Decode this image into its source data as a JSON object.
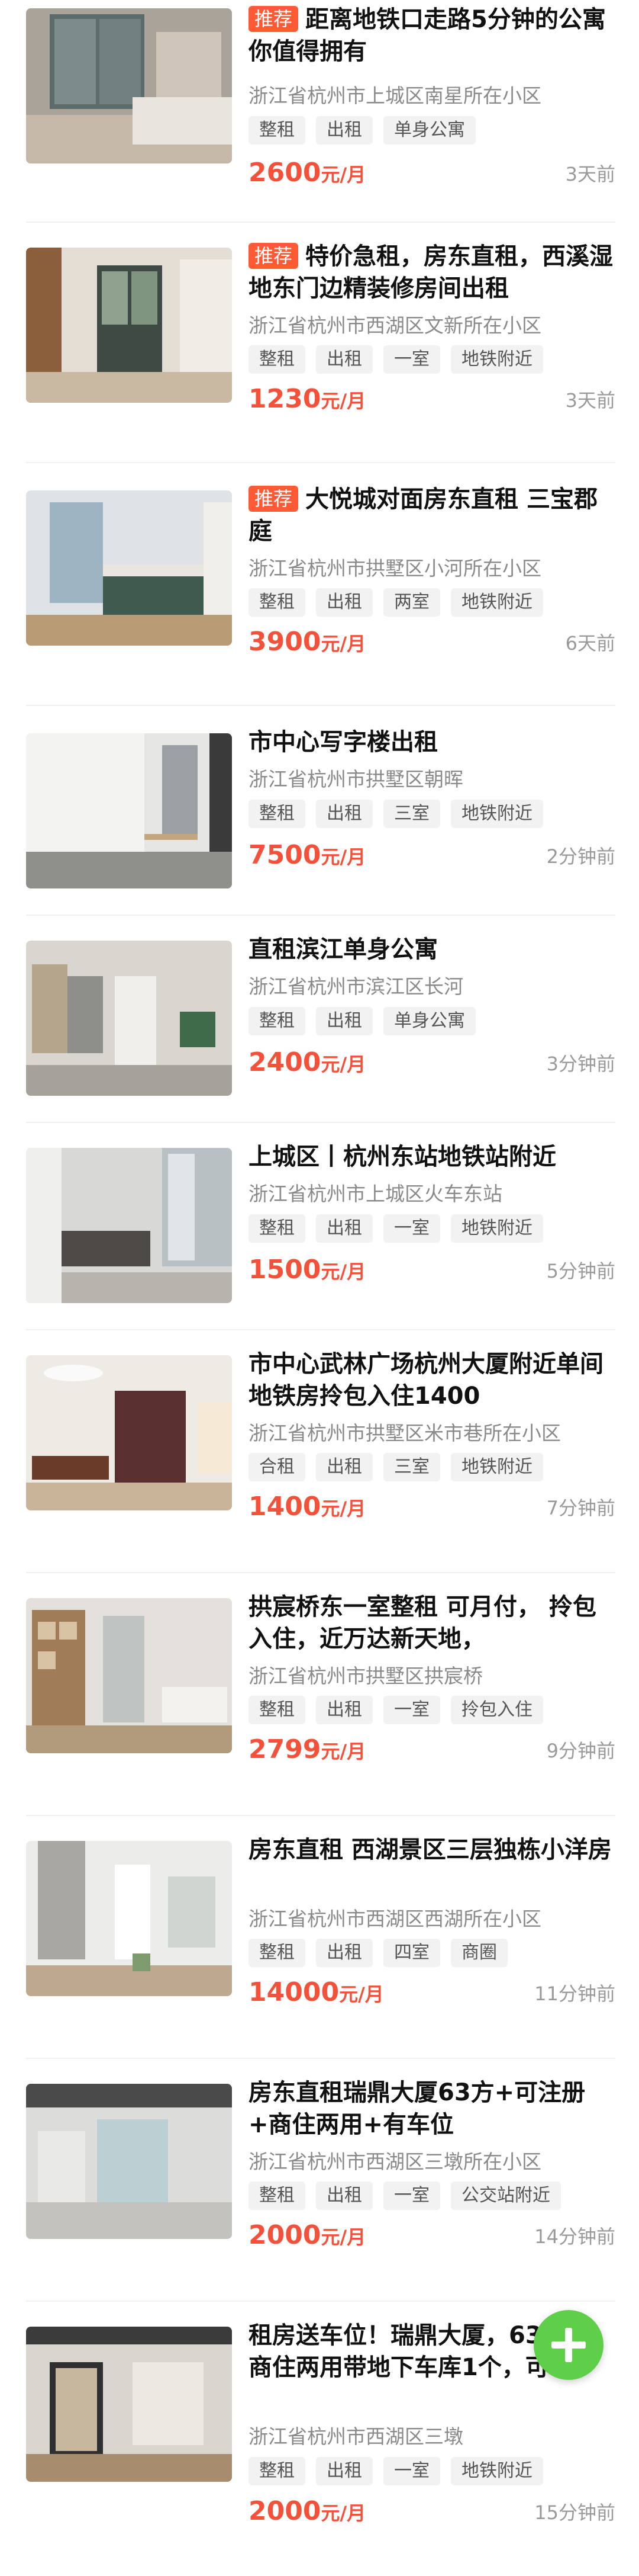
{
  "listings": [
    {
      "recommended": true,
      "badge": "推荐",
      "title": "距离地铁口走路5分钟的公寓你值得拥有",
      "address": "浙江省杭州市上城区南星所在小区",
      "tags": [
        "整租",
        "出租",
        "单身公寓"
      ],
      "price": "2600",
      "unit": "元/月",
      "time": "3天前"
    },
    {
      "recommended": true,
      "badge": "推荐",
      "title": "特价急租，房东直租，西溪湿地东门边精装修房间出租",
      "address": "浙江省杭州市西湖区文新所在小区",
      "tags": [
        "整租",
        "出租",
        "一室",
        "地铁附近"
      ],
      "price": "1230",
      "unit": "元/月",
      "time": "3天前"
    },
    {
      "recommended": true,
      "badge": "推荐",
      "title": "大悦城对面房东直租 三宝郡庭",
      "address": "浙江省杭州市拱墅区小河所在小区",
      "tags": [
        "整租",
        "出租",
        "两室",
        "地铁附近"
      ],
      "price": "3900",
      "unit": "元/月",
      "time": "6天前"
    },
    {
      "recommended": false,
      "title": "市中心写字楼出租",
      "address": "浙江省杭州市拱墅区朝晖",
      "tags": [
        "整租",
        "出租",
        "三室",
        "地铁附近"
      ],
      "price": "7500",
      "unit": "元/月",
      "time": "2分钟前"
    },
    {
      "recommended": false,
      "title": "直租滨江单身公寓",
      "address": "浙江省杭州市滨江区长河",
      "tags": [
        "整租",
        "出租",
        "单身公寓"
      ],
      "price": "2400",
      "unit": "元/月",
      "time": "3分钟前"
    },
    {
      "recommended": false,
      "title": "上城区丨杭州东站地铁站附近",
      "address": "浙江省杭州市上城区火车东站",
      "tags": [
        "整租",
        "出租",
        "一室",
        "地铁附近"
      ],
      "price": "1500",
      "unit": "元/月",
      "time": "5分钟前"
    },
    {
      "recommended": false,
      "title": "市中心武林广场杭州大厦附近单间地铁房拎包入住1400",
      "address": "浙江省杭州市拱墅区米市巷所在小区",
      "tags": [
        "合租",
        "出租",
        "三室",
        "地铁附近"
      ],
      "price": "1400",
      "unit": "元/月",
      "time": "7分钟前"
    },
    {
      "recommended": false,
      "title": "拱宸桥东一室整租 可月付， 拎包入住，近万达新天地，",
      "address": "浙江省杭州市拱墅区拱宸桥",
      "tags": [
        "整租",
        "出租",
        "一室",
        "拎包入住"
      ],
      "price": "2799",
      "unit": "元/月",
      "time": "9分钟前"
    },
    {
      "recommended": false,
      "title": "房东直租 西湖景区三层独栋小洋房",
      "address": "浙江省杭州市西湖区西湖所在小区",
      "tags": [
        "整租",
        "出租",
        "四室",
        "商圈"
      ],
      "price": "14000",
      "unit": "元/月",
      "time": "11分钟前"
    },
    {
      "recommended": false,
      "title": "房东直租瑞鼎大厦63方+可注册+商住两用+有车位",
      "address": "浙江省杭州市西湖区三墩所在小区",
      "tags": [
        "整租",
        "出租",
        "一室",
        "公交站附近"
      ],
      "price": "2000",
      "unit": "元/月",
      "time": "14分钟前"
    },
    {
      "recommended": false,
      "title": "租房送车位！瑞鼎大厦，63平米，商住两用带地下车库1个，可",
      "address": "浙江省杭州市西湖区三墩",
      "tags": [
        "整租",
        "出租",
        "一室",
        "地铁附近"
      ],
      "price": "2000",
      "unit": "元/月",
      "time": "15分钟前"
    }
  ],
  "fab": {
    "icon": "plus-icon"
  },
  "colors": {
    "accent": "#f4513b",
    "badge": "#ff5a36",
    "fab": "#5fcf4a"
  }
}
